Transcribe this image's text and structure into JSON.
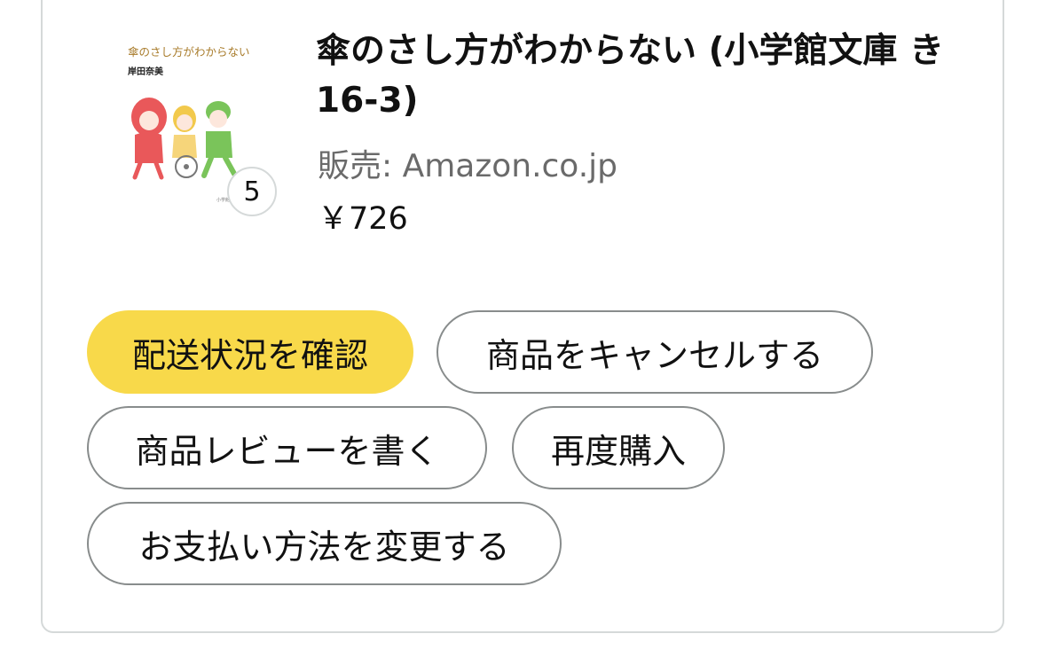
{
  "item": {
    "title": "傘のさし方がわからない (小学館文庫 き 16-3)",
    "seller": "販売: Amazon.co.jp",
    "price": "￥726",
    "quantity": "5",
    "cover": {
      "title": "傘のさし方がわからない",
      "author": "岸田奈美",
      "publisher": "小学館"
    }
  },
  "actions": {
    "track": "配送状況を確認",
    "cancel": "商品をキャンセルする",
    "review": "商品レビューを書く",
    "rebuy": "再度購入",
    "payment": "お支払い方法を変更する"
  },
  "colors": {
    "primary_button": "#f8d94a",
    "button_border": "#888c8c",
    "card_border": "#d5d9d9",
    "seller_text": "#6a6a6a"
  }
}
